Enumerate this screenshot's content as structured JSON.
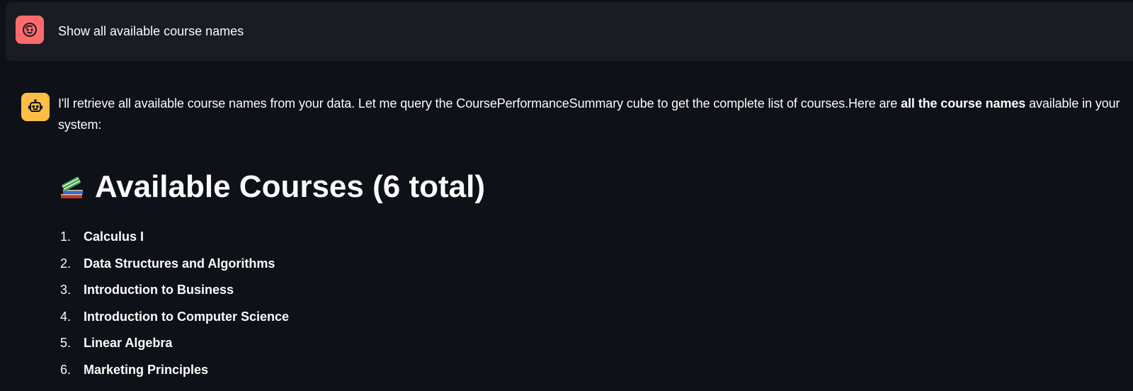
{
  "colors": {
    "background": "#0e1117",
    "user_bubble": "#1a1c24",
    "user_avatar": "#ff6b6b",
    "bot_avatar": "#ffbd45",
    "text": "#fafafa"
  },
  "user_message": {
    "avatar_icon": "smiley-face-icon",
    "text": "Show all available course names"
  },
  "assistant_message": {
    "avatar_icon": "robot-icon",
    "intro": "I'll retrieve all available course names from your data. Let me query the CoursePerformanceSummary cube to get the complete list of courses.Here are ",
    "intro_bold": "all the course names",
    "intro_end": " available in your system:",
    "heading_icon": "books-icon",
    "heading": "Available Courses (6 total)",
    "courses": [
      {
        "num": "1.",
        "name": "Calculus I"
      },
      {
        "num": "2.",
        "name": "Data Structures and Algorithms"
      },
      {
        "num": "3.",
        "name": "Introduction to Business"
      },
      {
        "num": "4.",
        "name": "Introduction to Computer Science"
      },
      {
        "num": "5.",
        "name": "Linear Algebra"
      },
      {
        "num": "6.",
        "name": "Marketing Principles"
      }
    ]
  }
}
